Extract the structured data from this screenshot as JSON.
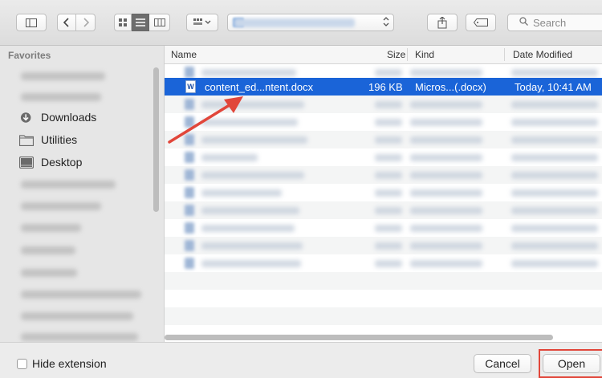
{
  "toolbar": {
    "search_placeholder": "Search"
  },
  "sidebar": {
    "section_title": "Favorites",
    "items": [
      {
        "label": "Downloads",
        "icon": "downloads-icon"
      },
      {
        "label": "Utilities",
        "icon": "folder-icon"
      },
      {
        "label": "Desktop",
        "icon": "desktop-icon"
      }
    ]
  },
  "file_list": {
    "columns": [
      "Name",
      "Size",
      "Kind",
      "Date Modified"
    ],
    "selected_file": {
      "name": "content_ed...ntent.docx",
      "size": "196 KB",
      "kind": "Micros...(.docx)",
      "date": "Today, 10:41 AM"
    }
  },
  "footer": {
    "hide_extension_label": "Hide extension",
    "cancel_label": "Cancel",
    "open_label": "Open"
  },
  "colors": {
    "selection": "#1a64d8",
    "annotation": "#e1463a"
  }
}
